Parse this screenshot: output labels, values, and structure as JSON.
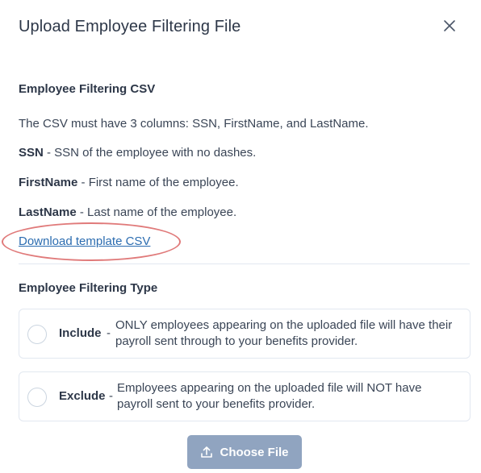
{
  "modal": {
    "title": "Upload Employee Filtering File"
  },
  "csv_section": {
    "heading": "Employee Filtering CSV",
    "intro": "The CSV must have 3 columns: SSN, FirstName, and LastName.",
    "fields": [
      {
        "name": "SSN",
        "description": " - SSN of the employee with no dashes."
      },
      {
        "name": "FirstName",
        "description": " - First name of the employee."
      },
      {
        "name": "LastName",
        "description": " - Last name of the employee."
      }
    ],
    "download_link": "Download template CSV"
  },
  "type_section": {
    "heading": "Employee Filtering Type",
    "options": [
      {
        "label": "Include",
        "dash": "-",
        "description": "ONLY employees appearing on the uploaded file will have their payroll sent through to your benefits provider."
      },
      {
        "label": "Exclude",
        "dash": "-",
        "description": "Employees appearing on the uploaded file will NOT have payroll sent to your benefits provider."
      }
    ]
  },
  "actions": {
    "choose_file": "Choose File"
  },
  "colors": {
    "link": "#2b6cb0",
    "annotation": "#e07a7a",
    "button_disabled": "#90a4c0"
  },
  "icons": {
    "close": "close-icon",
    "upload": "upload-icon"
  }
}
